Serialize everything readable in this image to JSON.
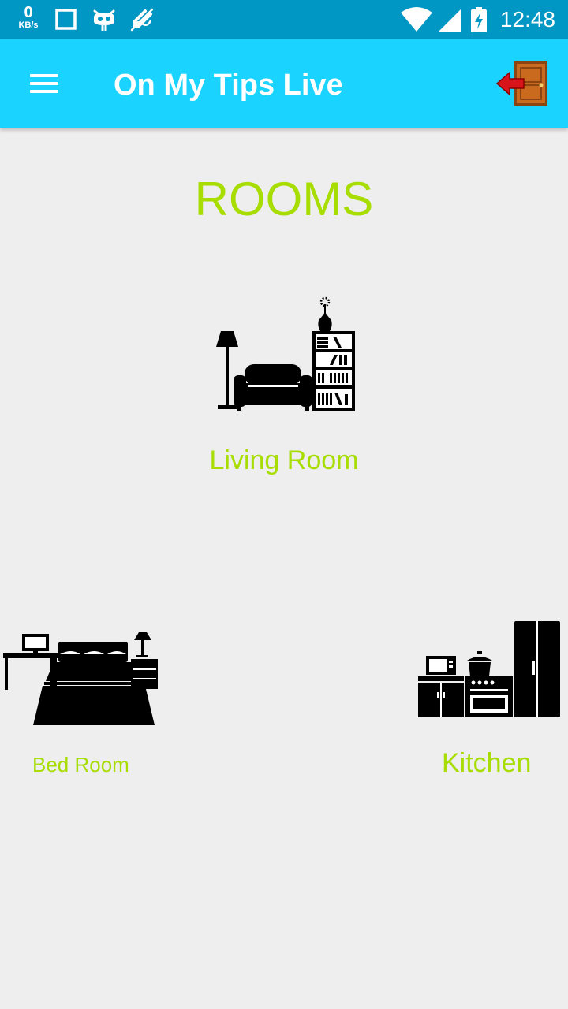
{
  "status_bar": {
    "speed_value": "0",
    "speed_unit": "KB/s",
    "time": "12:48",
    "icons": [
      "square-notification-icon",
      "cyanogen-mascot-icon",
      "no-location-icon",
      "wifi-icon",
      "cell-signal-icon",
      "battery-charging-icon"
    ]
  },
  "app_bar": {
    "title": "On My Tips Live",
    "menu_icon": "hamburger-menu-icon",
    "logout_icon": "exit-door-icon",
    "background": "#1ad4ff"
  },
  "main": {
    "heading": "ROOMS",
    "rooms": [
      {
        "label": "Living Room",
        "icon": "living-room-icon"
      },
      {
        "label": "Bed Room",
        "icon": "bedroom-icon"
      },
      {
        "label": "Kitchen",
        "icon": "kitchen-icon"
      }
    ]
  },
  "colors": {
    "status_bar": "#0097c4",
    "accent_text": "#a7dd00",
    "background": "#eeeeee",
    "icon_fill": "#000000"
  }
}
